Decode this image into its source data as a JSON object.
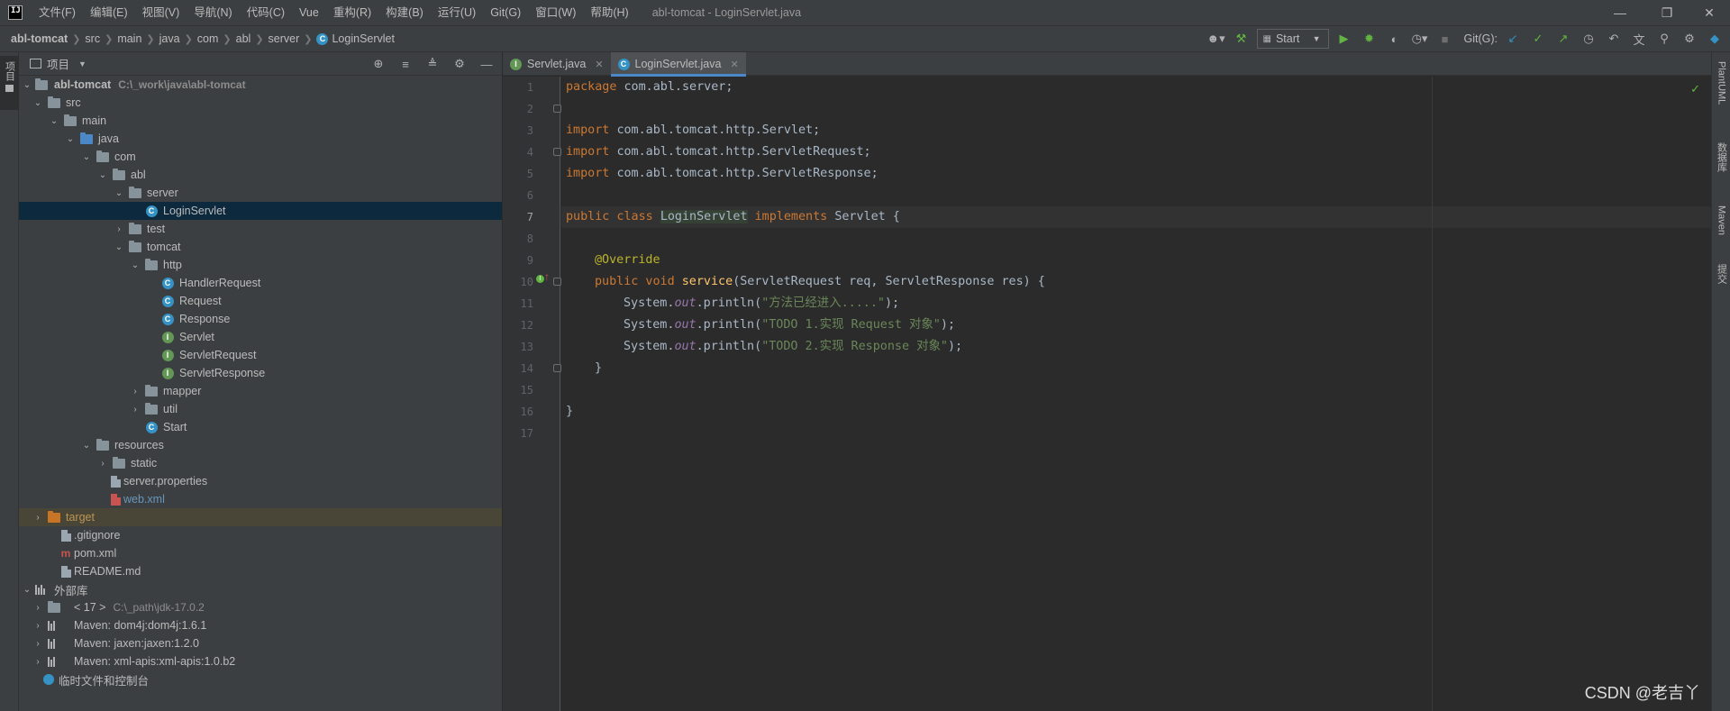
{
  "menubar": {
    "logo": "IJ",
    "items": [
      "文件(F)",
      "编辑(E)",
      "视图(V)",
      "导航(N)",
      "代码(C)",
      "Vue",
      "重构(R)",
      "构建(B)",
      "运行(U)",
      "Git(G)",
      "窗口(W)",
      "帮助(H)"
    ],
    "window_title": "abl-tomcat - LoginServlet.java"
  },
  "breadcrumb": [
    "abl-tomcat",
    "src",
    "main",
    "java",
    "com",
    "abl",
    "server",
    "LoginServlet"
  ],
  "toolbar": {
    "run_config": "Start",
    "git_label": "Git(G):"
  },
  "project_panel": {
    "title": "项目",
    "tree": [
      {
        "label": "abl-tomcat",
        "hint": "C:\\_work\\java\\abl-tomcat"
      },
      {
        "label": "src"
      },
      {
        "label": "main"
      },
      {
        "label": "java"
      },
      {
        "label": "com"
      },
      {
        "label": "abl"
      },
      {
        "label": "server"
      },
      {
        "label": "LoginServlet"
      },
      {
        "label": "test"
      },
      {
        "label": "tomcat"
      },
      {
        "label": "http"
      },
      {
        "label": "HandlerRequest"
      },
      {
        "label": "Request"
      },
      {
        "label": "Response"
      },
      {
        "label": "Servlet"
      },
      {
        "label": "ServletRequest"
      },
      {
        "label": "ServletResponse"
      },
      {
        "label": "mapper"
      },
      {
        "label": "util"
      },
      {
        "label": "Start"
      },
      {
        "label": "resources"
      },
      {
        "label": "static"
      },
      {
        "label": "server.properties"
      },
      {
        "label": "web.xml"
      },
      {
        "label": "target"
      },
      {
        "label": ".gitignore"
      },
      {
        "label": "pom.xml"
      },
      {
        "label": "README.md"
      },
      {
        "label": "外部库"
      },
      {
        "label": "< 17 >",
        "hint": "C:\\_path\\jdk-17.0.2"
      },
      {
        "label": "Maven: dom4j:dom4j:1.6.1"
      },
      {
        "label": "Maven: jaxen:jaxen:1.2.0"
      },
      {
        "label": "Maven: xml-apis:xml-apis:1.0.b2"
      },
      {
        "label": "临时文件和控制台"
      }
    ]
  },
  "editor": {
    "tabs": [
      {
        "label": "Servlet.java"
      },
      {
        "label": "LoginServlet.java"
      }
    ],
    "line_numbers": [
      "1",
      "2",
      "3",
      "4",
      "5",
      "6",
      "7",
      "8",
      "9",
      "10",
      "11",
      "12",
      "13",
      "14",
      "15",
      "16",
      "17"
    ],
    "code": {
      "l1_kw": "package ",
      "l1_rest": "com.abl.server;",
      "l3_kw": "import ",
      "l3_rest": "com.abl.tomcat.http.Servlet;",
      "l4_kw": "import ",
      "l4_rest": "com.abl.tomcat.http.ServletRequest;",
      "l5_kw": "import ",
      "l5_rest": "com.abl.tomcat.http.ServletResponse;",
      "l7_kw1": "public class ",
      "l7_name": "LoginServlet",
      "l7_kw2": " implements ",
      "l7_rest": "Servlet {",
      "l9_ann": "@Override",
      "l10_kw": "public void ",
      "l10_fn": "service",
      "l10_rest": "(ServletRequest req, ServletResponse res) {",
      "l11_a": "System.",
      "l11_f": "out",
      "l11_b": ".println(",
      "l11_s": "\"方法已经进入.....\"",
      "l11_c": ");",
      "l12_a": "System.",
      "l12_f": "out",
      "l12_b": ".println(",
      "l12_s": "\"TODO 1.实现 Request 对象\"",
      "l12_c": ");",
      "l13_a": "System.",
      "l13_f": "out",
      "l13_b": ".println(",
      "l13_s": "\"TODO 2.实现 Response 对象\"",
      "l13_c": ");",
      "l14": "}",
      "l16": "}"
    }
  },
  "right_strip": [
    "PlantUML",
    "数据库",
    "Maven",
    "提交"
  ],
  "watermark": "CSDN @老吉丫",
  "colors": {
    "keyword": "#cc7832",
    "string": "#6a8759",
    "annotation": "#bbb529",
    "method": "#ffc66d",
    "selection": "#0d293e"
  }
}
